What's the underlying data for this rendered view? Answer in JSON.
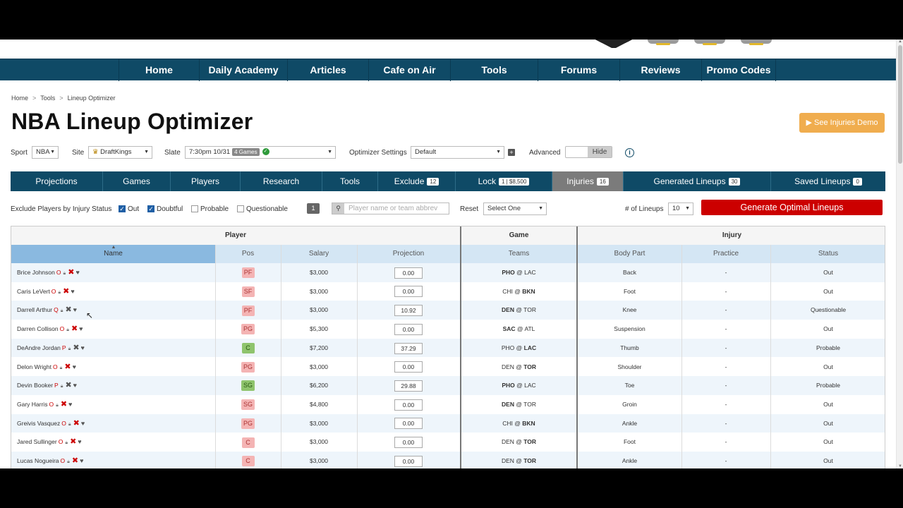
{
  "nav": {
    "items": [
      "Home",
      "Daily Academy",
      "Articles",
      "Cafe on Air",
      "Tools",
      "Forums",
      "Reviews",
      "Promo Codes"
    ]
  },
  "breadcrumb": [
    "Home",
    "Tools",
    "Lineup Optimizer"
  ],
  "page_title": "NBA Lineup Optimizer",
  "injuries_demo_label": "See Injuries Demo",
  "controls": {
    "sport_label": "Sport",
    "sport_value": "NBA",
    "site_label": "Site",
    "site_value": "DraftKings",
    "slate_label": "Slate",
    "slate_value": "7:30pm 10/31",
    "slate_games": "4 Games",
    "optimizer_label": "Optimizer Settings",
    "optimizer_value": "Default",
    "advanced_label": "Advanced",
    "advanced_toggle": "Hide"
  },
  "tabs": [
    {
      "label": "Projections",
      "count": ""
    },
    {
      "label": "Games",
      "count": ""
    },
    {
      "label": "Players",
      "count": ""
    },
    {
      "label": "Research",
      "count": ""
    },
    {
      "label": "Tools",
      "count": ""
    },
    {
      "label": "Exclude",
      "count": "12"
    },
    {
      "label": "Lock",
      "count": "1 | $8,500"
    },
    {
      "label": "Injuries",
      "count": "16"
    },
    {
      "label": "Generated Lineups",
      "count": "30"
    },
    {
      "label": "Saved Lineups",
      "count": "0"
    }
  ],
  "filters": {
    "exclude_label": "Exclude Players by Injury Status",
    "out": "Out",
    "doubtful": "Doubtful",
    "probable": "Probable",
    "questionable": "Questionable",
    "page": "1",
    "search_placeholder": "Player name or team abbrev",
    "reset_label": "Reset",
    "reset_value": "Select One",
    "lineups_label": "# of Lineups",
    "lineups_value": "10",
    "generate_label": "Generate Optimal Lineups"
  },
  "table": {
    "groups": [
      "Player",
      "Game",
      "Injury"
    ],
    "columns": [
      "Name",
      "Pos",
      "Salary",
      "Projection",
      "Teams",
      "Body Part",
      "Practice",
      "Status"
    ],
    "rows": [
      {
        "name": "Brice Johnson",
        "status_code": "O",
        "pos": "PF",
        "salary": "$3,000",
        "proj": "0.00",
        "away": "PHO",
        "home": "LAC",
        "bold": "away",
        "body": "Back",
        "practice": "-",
        "status": "Out"
      },
      {
        "name": "Caris LeVert",
        "status_code": "O",
        "pos": "SF",
        "salary": "$3,000",
        "proj": "0.00",
        "away": "CHI",
        "home": "BKN",
        "bold": "home",
        "body": "Foot",
        "practice": "-",
        "status": "Out"
      },
      {
        "name": "Darrell Arthur",
        "status_code": "Q",
        "pos": "PF",
        "salary": "$3,000",
        "proj": "10.92",
        "away": "DEN",
        "home": "TOR",
        "bold": "away",
        "body": "Knee",
        "practice": "-",
        "status": "Questionable"
      },
      {
        "name": "Darren Collison",
        "status_code": "O",
        "pos": "PG",
        "salary": "$5,300",
        "proj": "0.00",
        "away": "SAC",
        "home": "ATL",
        "bold": "away",
        "body": "Suspension",
        "practice": "-",
        "status": "Out"
      },
      {
        "name": "DeAndre Jordan",
        "status_code": "P",
        "pos": "C",
        "salary": "$7,200",
        "proj": "37.29",
        "away": "PHO",
        "home": "LAC",
        "bold": "home",
        "body": "Thumb",
        "practice": "-",
        "status": "Probable"
      },
      {
        "name": "Delon Wright",
        "status_code": "O",
        "pos": "PG",
        "salary": "$3,000",
        "proj": "0.00",
        "away": "DEN",
        "home": "TOR",
        "bold": "home",
        "body": "Shoulder",
        "practice": "-",
        "status": "Out"
      },
      {
        "name": "Devin Booker",
        "status_code": "P",
        "pos": "SG",
        "salary": "$6,200",
        "proj": "29.88",
        "away": "PHO",
        "home": "LAC",
        "bold": "away",
        "body": "Toe",
        "practice": "-",
        "status": "Probable"
      },
      {
        "name": "Gary Harris",
        "status_code": "O",
        "pos": "SG",
        "salary": "$4,800",
        "proj": "0.00",
        "away": "DEN",
        "home": "TOR",
        "bold": "away",
        "body": "Groin",
        "practice": "-",
        "status": "Out"
      },
      {
        "name": "Greivis Vasquez",
        "status_code": "O",
        "pos": "PG",
        "salary": "$3,000",
        "proj": "0.00",
        "away": "CHI",
        "home": "BKN",
        "bold": "home",
        "body": "Ankle",
        "practice": "-",
        "status": "Out"
      },
      {
        "name": "Jared Sullinger",
        "status_code": "O",
        "pos": "C",
        "salary": "$3,000",
        "proj": "0.00",
        "away": "DEN",
        "home": "TOR",
        "bold": "home",
        "body": "Foot",
        "practice": "-",
        "status": "Out"
      },
      {
        "name": "Lucas Nogueira",
        "status_code": "O",
        "pos": "C",
        "salary": "$3,000",
        "proj": "0.00",
        "away": "DEN",
        "home": "TOR",
        "bold": "home",
        "body": "Ankle",
        "practice": "-",
        "status": "Out"
      }
    ]
  },
  "colors": {
    "nav_bg": "#0f4a66",
    "generate_bg": "#cc0000",
    "demo_bg": "#f0ad4e",
    "pos_badge_red": "#f4b4b4",
    "pos_badge_green": "#8fc46d"
  }
}
